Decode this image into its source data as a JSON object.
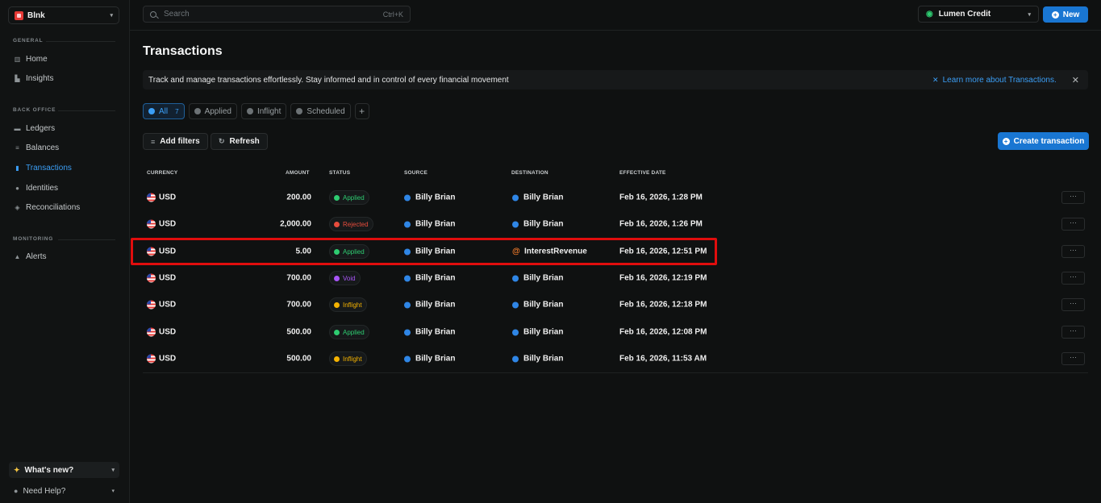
{
  "sidebar": {
    "workspace": "Blnk",
    "sections": [
      {
        "label": "GENERAL",
        "items": [
          {
            "label": "Home",
            "icon": "home-icon"
          },
          {
            "label": "Insights",
            "icon": "chart-icon"
          }
        ]
      },
      {
        "label": "BACK OFFICE",
        "items": [
          {
            "label": "Ledgers",
            "icon": "folder-icon"
          },
          {
            "label": "Balances",
            "icon": "database-icon"
          },
          {
            "label": "Transactions",
            "icon": "transactions-icon"
          },
          {
            "label": "Identities",
            "icon": "users-icon"
          },
          {
            "label": "Reconciliations",
            "icon": "reconcile-icon"
          }
        ]
      },
      {
        "label": "MONITORING",
        "items": [
          {
            "label": "Alerts",
            "icon": "bell-icon"
          }
        ]
      }
    ],
    "whats_new": "What's new?",
    "need_help": "Need Help?"
  },
  "topbar": {
    "search_placeholder": "Search",
    "search_shortcut": "Ctrl+K",
    "ledger": "Lumen Credit",
    "new_label": "New"
  },
  "main": {
    "title": "Transactions",
    "banner_text": "Track and manage transactions effortlessly. Stay informed and in control of every financial movement",
    "banner_link": "Learn more about Transactions.",
    "tabs": [
      {
        "label": "All",
        "count": "7"
      },
      {
        "label": "Applied"
      },
      {
        "label": "Inflight"
      },
      {
        "label": "Scheduled"
      }
    ],
    "add_filters": "Add filters",
    "refresh": "Refresh",
    "create": "Create transaction",
    "columns": [
      "CURRENCY",
      "AMOUNT",
      "STATUS",
      "SOURCE",
      "DESTINATION",
      "EFFECTIVE DATE"
    ],
    "rows": [
      {
        "currency": "USD",
        "amount": "200.00",
        "status": "Applied",
        "source": "Billy Brian",
        "destination": "Billy Brian",
        "date": "Feb 16, 2026, 1:28 PM"
      },
      {
        "currency": "USD",
        "amount": "2,000.00",
        "status": "Rejected",
        "source": "Billy Brian",
        "destination": "Billy Brian",
        "date": "Feb 16, 2026, 1:26 PM"
      },
      {
        "currency": "USD",
        "amount": "5.00",
        "status": "Applied",
        "source": "Billy Brian",
        "destination": "InterestRevenue",
        "date": "Feb 16, 2026, 12:51 PM"
      },
      {
        "currency": "USD",
        "amount": "700.00",
        "status": "Void",
        "source": "Billy Brian",
        "destination": "Billy Brian",
        "date": "Feb 16, 2026, 12:19 PM"
      },
      {
        "currency": "USD",
        "amount": "700.00",
        "status": "Inflight",
        "source": "Billy Brian",
        "destination": "Billy Brian",
        "date": "Feb 16, 2026, 12:18 PM"
      },
      {
        "currency": "USD",
        "amount": "500.00",
        "status": "Applied",
        "source": "Billy Brian",
        "destination": "Billy Brian",
        "date": "Feb 16, 2026, 12:08 PM"
      },
      {
        "currency": "USD",
        "amount": "500.00",
        "status": "Inflight",
        "source": "Billy Brian",
        "destination": "Billy Brian",
        "date": "Feb 16, 2026, 11:53 AM"
      }
    ],
    "more_label": "···"
  },
  "colors": {
    "accent": "#1976d2",
    "applied": "#2ecc71",
    "rejected": "#e74c3c",
    "void": "#a855f7",
    "inflight": "#f5b301",
    "highlight": "#e00d0d"
  }
}
